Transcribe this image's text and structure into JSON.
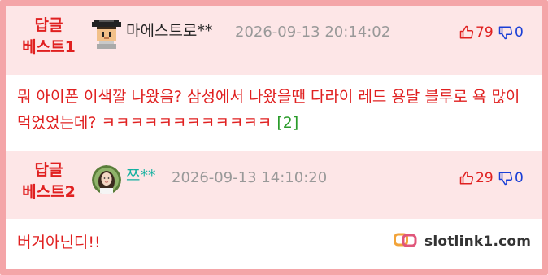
{
  "comments": [
    {
      "best_label_line1": "답글",
      "best_label_line2": "베스트1",
      "nickname": "마에스트로**",
      "timestamp": "2026-09-13 20:14:02",
      "upvotes": "79",
      "downvotes": "0",
      "avatar_icon": "pixel-character-icon",
      "text": "뭐 아이폰 이색깔 나왔음? 삼성에서 나왔을땐 다라이 레드 용달 블루로 욕 많이 먹었었는데? ㅋㅋㅋㅋㅋㅋㅋㅋㅋㅋㅋㅋ",
      "reply_count": "[2]"
    },
    {
      "best_label_line1": "답글",
      "best_label_line2": "베스트2",
      "nickname": "쯔**",
      "timestamp": "2026-09-13 14:10:20",
      "upvotes": "29",
      "downvotes": "0",
      "avatar_icon": "portrait-avatar-icon",
      "text": "버거아닌디!!",
      "reply_count": ""
    }
  ],
  "watermark": {
    "text": "slotlink1.com",
    "icon": "chain-link-icon"
  },
  "colors": {
    "frame_border": "#f4a5a8",
    "header_bg": "#fde6e7",
    "accent_red": "#e02020",
    "vote_down_blue": "#1a3fd6",
    "nickname_teal": "#13b0a0",
    "reply_green": "#2a9c2a"
  }
}
